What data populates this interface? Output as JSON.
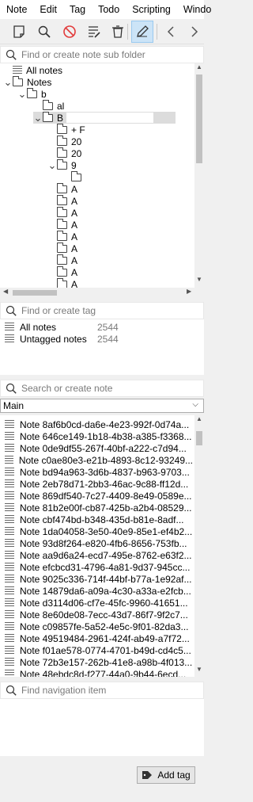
{
  "menu": [
    "Note",
    "Edit",
    "Tag",
    "Todo",
    "Scripting",
    "Windo"
  ],
  "toolbar_icons": [
    "new-note-icon",
    "search-icon",
    "no-entry-icon",
    "edit-list-icon",
    "trash-icon",
    "pencil-icon",
    "arrow-left-icon",
    "arrow-right-icon"
  ],
  "folder_search": {
    "placeholder": "Find or create note sub folder"
  },
  "folder_tree": [
    {
      "label": "All notes",
      "expander": "",
      "kind": "notes"
    },
    {
      "label": "Notes",
      "expander": "v",
      "kind": "folder"
    },
    {
      "label": "b",
      "expander": "v",
      "kind": "folder"
    },
    {
      "label": "al",
      "expander": "",
      "kind": "folder"
    },
    {
      "label": "B",
      "expander": "v",
      "kind": "folder",
      "selected": true
    },
    {
      "label": "+ F",
      "expander": "",
      "kind": "folder"
    },
    {
      "label": "20",
      "expander": "",
      "kind": "folder"
    },
    {
      "label": "20",
      "expander": "",
      "kind": "folder"
    },
    {
      "label": "9",
      "expander": "v",
      "kind": "folder"
    },
    {
      "label": "",
      "expander": "",
      "kind": "folder"
    },
    {
      "label": "A",
      "expander": "",
      "kind": "folder"
    },
    {
      "label": "A",
      "expander": "",
      "kind": "folder"
    },
    {
      "label": "A",
      "expander": "",
      "kind": "folder"
    },
    {
      "label": "A",
      "expander": "",
      "kind": "folder"
    },
    {
      "label": "A",
      "expander": "",
      "kind": "folder"
    },
    {
      "label": "A",
      "expander": "",
      "kind": "folder"
    },
    {
      "label": "A",
      "expander": "",
      "kind": "folder"
    },
    {
      "label": "A",
      "expander": "",
      "kind": "folder"
    },
    {
      "label": "A",
      "expander": "",
      "kind": "folder"
    },
    {
      "label": "A",
      "expander": "",
      "kind": "folder"
    }
  ],
  "tag_search": {
    "placeholder": "Find or create tag"
  },
  "tags": [
    {
      "label": "All notes",
      "count": "2544"
    },
    {
      "label": "Untagged notes",
      "count": "2544"
    }
  ],
  "note_search": {
    "placeholder": "Search or create note"
  },
  "workspace": {
    "selected": "Main"
  },
  "notes": [
    "Note 8af6b0cd-da6e-4e23-992f-0d74a...",
    "Note 646ce149-1b18-4b38-a385-f3368...",
    "Note 0de9df55-267f-40bf-a222-c7d94...",
    "Note c0ae80e3-e21b-4893-8c12-93249...",
    "Note bd94a963-3d6b-4837-b963-9703...",
    "Note 2eb78d71-2bb3-46ac-9c88-ff12d...",
    "Note 869df540-7c27-4409-8e49-0589e...",
    "Note 81b2e00f-cb87-425b-a2b4-08529...",
    "Note cbf474bd-b348-435d-b81e-8adf...",
    "Note 1da04058-3e50-40e9-85e1-ef4b2...",
    "Note 93d8f264-e820-4fb6-8656-753fb...",
    "Note aa9d6a24-ecd7-495e-8762-e63f2...",
    "Note efcbcd31-4796-4a81-9d37-945cc...",
    "Note 9025c336-714f-44bf-b77a-1e92af...",
    "Note 14879da6-a09a-4c30-a33a-e2fcb...",
    "Note d3114d06-cf7e-45fc-9960-41651...",
    "Note 8e60de08-7ecc-43d7-86f7-9f2c7...",
    "Note c09857fe-5a52-4e5c-9f01-82da3...",
    "Note 49519484-2961-424f-ab49-a7f72...",
    "Note f01ae578-0774-4701-b49d-cd4c5...",
    "Note 72b3e157-262b-41e8-a98b-4f013...",
    "Note 48ebdc8d-f277-44a0-9b44-6ecd..."
  ],
  "nav_search": {
    "placeholder": "Find navigation item"
  },
  "add_tag": {
    "label": "Add tag"
  }
}
